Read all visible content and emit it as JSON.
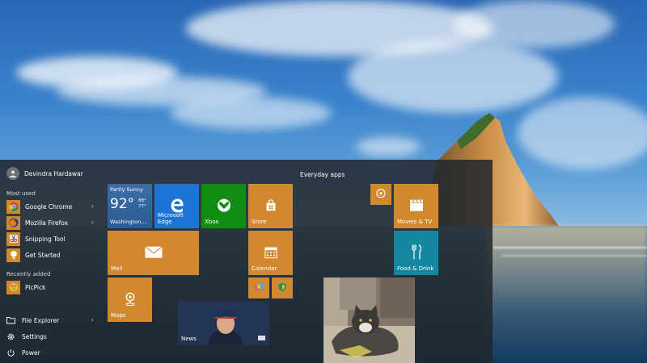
{
  "user": {
    "name": "Devindra Hardawar"
  },
  "most_used": {
    "label": "Most used",
    "items": [
      {
        "label": "Google Chrome",
        "icon": "chrome-icon"
      },
      {
        "label": "Mozilla Firefox",
        "icon": "firefox-icon"
      },
      {
        "label": "Snipping Tool",
        "icon": "snipping-tool-icon"
      },
      {
        "label": "Get Started",
        "icon": "lightbulb-icon"
      }
    ]
  },
  "recently_added": {
    "label": "Recently added",
    "items": [
      {
        "label": "PicPick",
        "icon": "picpick-icon"
      }
    ]
  },
  "bottom": {
    "file_explorer": "File Explorer",
    "settings": "Settings",
    "power": "Power"
  },
  "group_label": "Everyday apps",
  "tiles": {
    "weather": {
      "condition": "Partly Sunny",
      "temp": "92°",
      "high": "88°",
      "low": "77°",
      "city": "Washington,..."
    },
    "edge": "Microsoft Edge",
    "xbox": "Xbox",
    "store": "Store",
    "mail": "Mail",
    "calendar": "Calendar",
    "maps": "Maps",
    "news": "News",
    "movies": "Movies & TV",
    "food": "Food & Drink"
  },
  "colors": {
    "accent": "#d2882d",
    "edge": "#1e73d6",
    "xbox": "#118e12",
    "weather": "#2b5c93",
    "food": "#1387a0",
    "menu_bg": "#22262c"
  }
}
